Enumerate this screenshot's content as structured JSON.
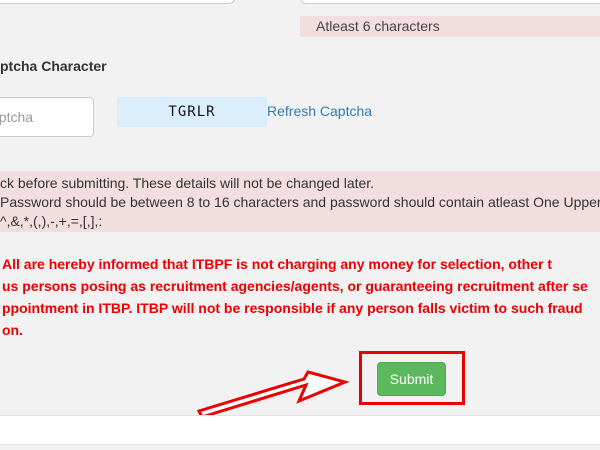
{
  "password_hint": "Atleast 6 characters",
  "captcha": {
    "label": "ptcha Character",
    "input_placeholder": "aptcha",
    "code": "TGRLR",
    "refresh_label": "Refresh Captcha"
  },
  "notice": {
    "line1": "ck before submitting. These details will not be changed later.",
    "line2": "Password should be between 8 to 16 characters and password should contain atleast One Upper",
    "line3": "^,&,*,(,),-,+,=,[,],:"
  },
  "warning": {
    "line1": "All are hereby informed that ITBPF is not charging any money for selection, other t",
    "line2": "us persons posing as recruitment agencies/agents, or guaranteeing recruitment after se",
    "line3": "ppointment in ITBP. ITBP will not be responsible if any person falls victim to such fraud",
    "line4": "on."
  },
  "submit_label": "Submit",
  "colors": {
    "accent_red": "#ee0000",
    "submit_green": "#5cb85c",
    "notice_bg": "#f2dede",
    "captcha_bg": "#dbeefc",
    "link_blue": "#337ab7"
  },
  "icons": [
    "pointer-arrow-icon"
  ]
}
